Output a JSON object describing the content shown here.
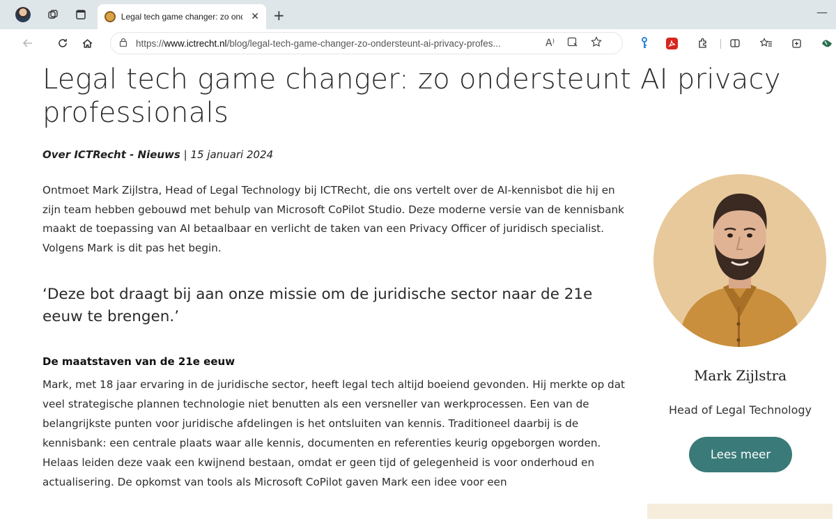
{
  "browser": {
    "tab_title": "Legal tech game changer: zo ondersteunt AI privacy professionals",
    "new_tab_glyph": "+",
    "tab_close_glyph": "✕",
    "minimize_glyph": "—",
    "url_prefix": "https://",
    "url_host": "www.ictrecht.nl",
    "url_path": "/blog/legal-tech-game-changer-zo-ondersteunt-ai-privacy-profes...",
    "read_aloud_glyph": "A⁾",
    "icons": [
      "profile-avatar-icon",
      "workspaces-icon",
      "tab-actions-icon",
      "favicon-icon",
      "back-icon",
      "refresh-icon",
      "home-icon",
      "lock-icon",
      "read-aloud-icon",
      "immersive-reader-icon",
      "favorite-star-icon",
      "password-key-icon",
      "pdf-extension-icon",
      "extensions-icon",
      "split-screen-icon",
      "favorites-icon",
      "collections-icon",
      "copilot-icon"
    ]
  },
  "article": {
    "title": "Legal tech game changer: zo ondersteunt AI privacy professionals",
    "category": "Over ICTRecht - Nieuws",
    "date": " | 15 januari 2024",
    "intro": "Ontmoet Mark Zijlstra, Head of Legal Technology bij ICTRecht, die ons vertelt over de AI-kennisbot die hij en zijn team hebben gebouwd met behulp van Microsoft CoPilot Studio. Deze moderne versie van de kennisbank maakt de toepassing van AI betaalbaar en verlicht de taken van een Privacy Officer of juridisch specialist. Volgens Mark is dit pas het begin.",
    "quote": "‘Deze bot draagt bij aan onze missie om de juridische sector naar de 21e eeuw te brengen.’",
    "subheading": "De maatstaven van de 21e eeuw",
    "body": "Mark, met 18 jaar ervaring in de juridische sector, heeft legal tech altijd boeiend gevonden. Hij merkte op dat veel strategische plannen technologie niet benutten als een versneller van werkprocessen. Een van de belangrijkste punten voor juridische afdelingen is het ontsluiten van kennis. Traditioneel daarbij is de kennisbank: een centrale plaats waar alle kennis, documenten en referenties keurig opgeborgen worden. Helaas leiden deze vaak een kwijnend bestaan, omdat er geen tijd of gelegenheid is voor onderhoud en actualisering. De opkomst van tools als Microsoft CoPilot gaven Mark een idee voor een"
  },
  "sidebar": {
    "name": "Mark Zijlstra",
    "role": "Head of Legal Technology",
    "button_label": "Lees meer"
  },
  "colors": {
    "button": "#3a7a79",
    "portrait_bg": "#e8c99c",
    "shirt": "#c98f3c",
    "tabbar": "#dfe6ea",
    "card": "#f7eddd"
  }
}
